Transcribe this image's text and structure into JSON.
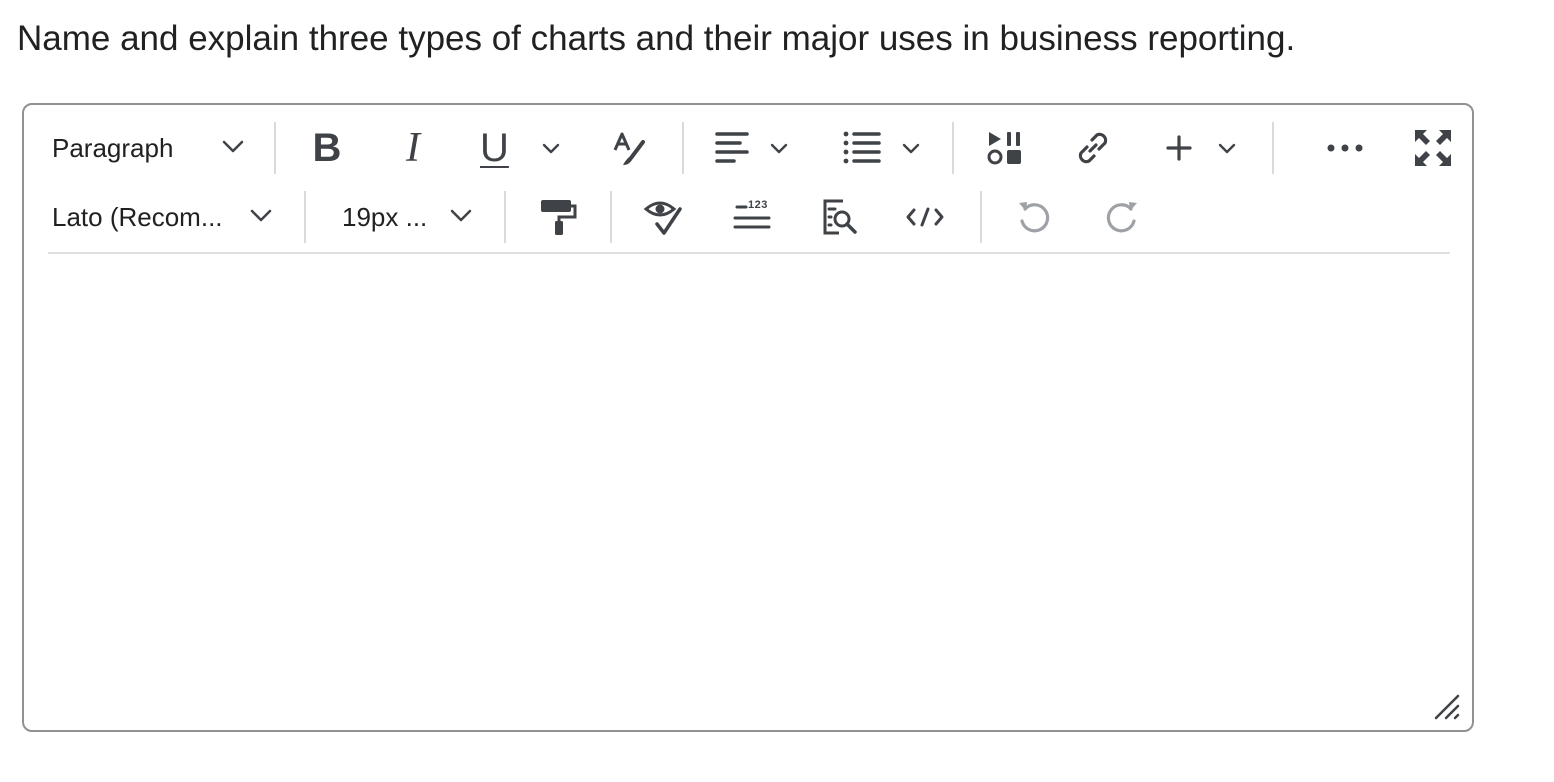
{
  "question": {
    "text": "Name and explain three types of charts and their major uses in business reporting."
  },
  "editor": {
    "row1": {
      "block_format": "Paragraph",
      "bold_label": "B",
      "italic_label": "I",
      "underline_label": "U"
    },
    "row2": {
      "font_family": "Lato (Recom...",
      "font_size": "19px ...",
      "word_count_badge": "123"
    },
    "content": ""
  },
  "icons": {
    "block_format_dropdown": "chevron-down-icon",
    "text_color": "text-color-brush-icon",
    "align": "align-left-icon",
    "list": "bullet-list-icon",
    "media": "insert-media-icon",
    "link": "link-icon",
    "insert": "plus-icon",
    "more": "more-horizontal-icon",
    "fullscreen": "fullscreen-icon",
    "format_painter": "format-painter-icon",
    "accessibility": "accessibility-checker-icon",
    "word_count": "word-count-icon",
    "preview": "preview-icon",
    "source": "source-code-icon",
    "undo": "undo-icon",
    "redo": "redo-icon"
  },
  "colors": {
    "icon": "#3f4246",
    "icon_disabled": "#9ea1a5",
    "border": "#8f9195",
    "separator": "#d8dadd"
  }
}
